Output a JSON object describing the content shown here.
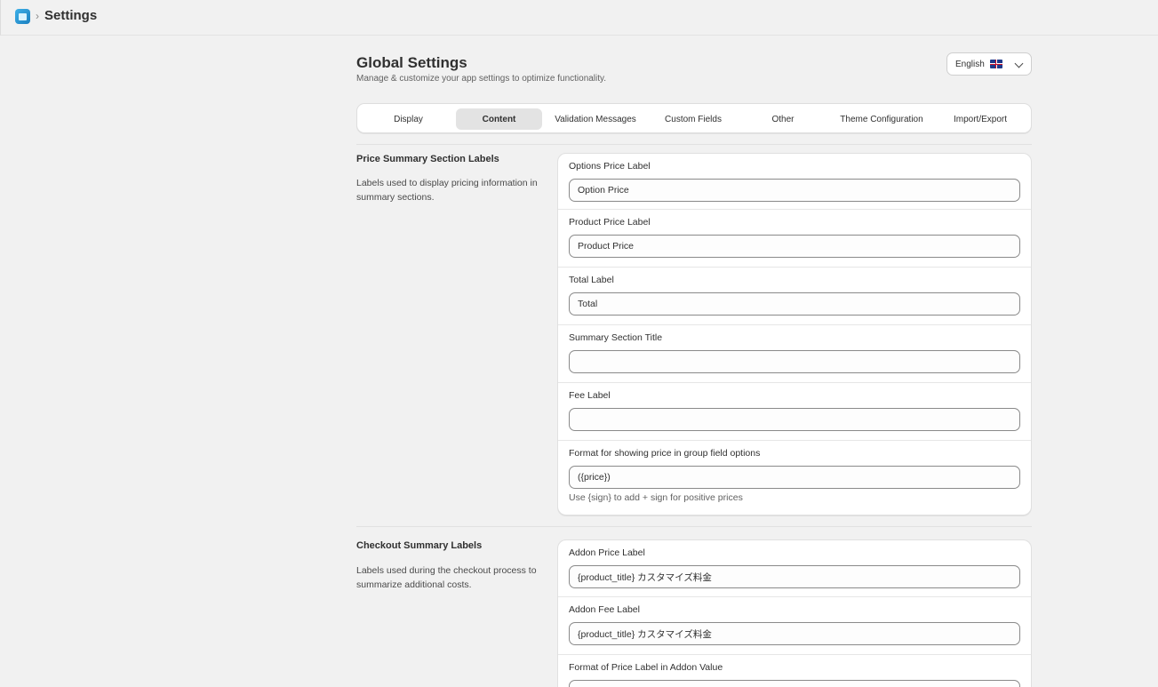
{
  "header": {
    "app_icon": "app-icon",
    "breadcrumb_separator": "›",
    "title": "Settings"
  },
  "page": {
    "title": "Global Settings",
    "subtitle": "Manage & customize your app settings to optimize functionality."
  },
  "language": {
    "selected": "English",
    "flag_icon": "uk-flag-icon",
    "chevron_icon": "chevron-down-icon"
  },
  "tabs": [
    {
      "label": "Display",
      "active": false
    },
    {
      "label": "Content",
      "active": true
    },
    {
      "label": "Validation Messages",
      "active": false
    },
    {
      "label": "Custom Fields",
      "active": false
    },
    {
      "label": "Other",
      "active": false
    },
    {
      "label": "Theme Configuration",
      "active": false
    },
    {
      "label": "Import/Export",
      "active": false
    }
  ],
  "sections": [
    {
      "title": "Price Summary Section Labels",
      "description": "Labels used to display pricing information in summary sections.",
      "fields": [
        {
          "label": "Options Price Label",
          "value": "Option Price",
          "placeholder": ""
        },
        {
          "label": "Product Price Label",
          "value": "Product Price",
          "placeholder": ""
        },
        {
          "label": "Total Label",
          "value": "Total",
          "placeholder": ""
        },
        {
          "label": "Summary Section Title",
          "value": "",
          "placeholder": ""
        },
        {
          "label": "Fee Label",
          "value": "",
          "placeholder": ""
        },
        {
          "label": "Format for showing price in group field options",
          "value": "({price})",
          "placeholder": "",
          "help": "Use {sign} to add + sign for positive prices"
        }
      ]
    },
    {
      "title": "Checkout Summary Labels",
      "description": "Labels used during the checkout process to summarize additional costs.",
      "fields": [
        {
          "label": "Addon Price Label",
          "value": "{product_title} カスタマイズ料金",
          "placeholder": ""
        },
        {
          "label": "Addon Fee Label",
          "value": "{product_title} カスタマイズ料金",
          "placeholder": ""
        },
        {
          "label": "Format of Price Label in Addon Value",
          "value": "",
          "placeholder": ""
        }
      ]
    }
  ]
}
